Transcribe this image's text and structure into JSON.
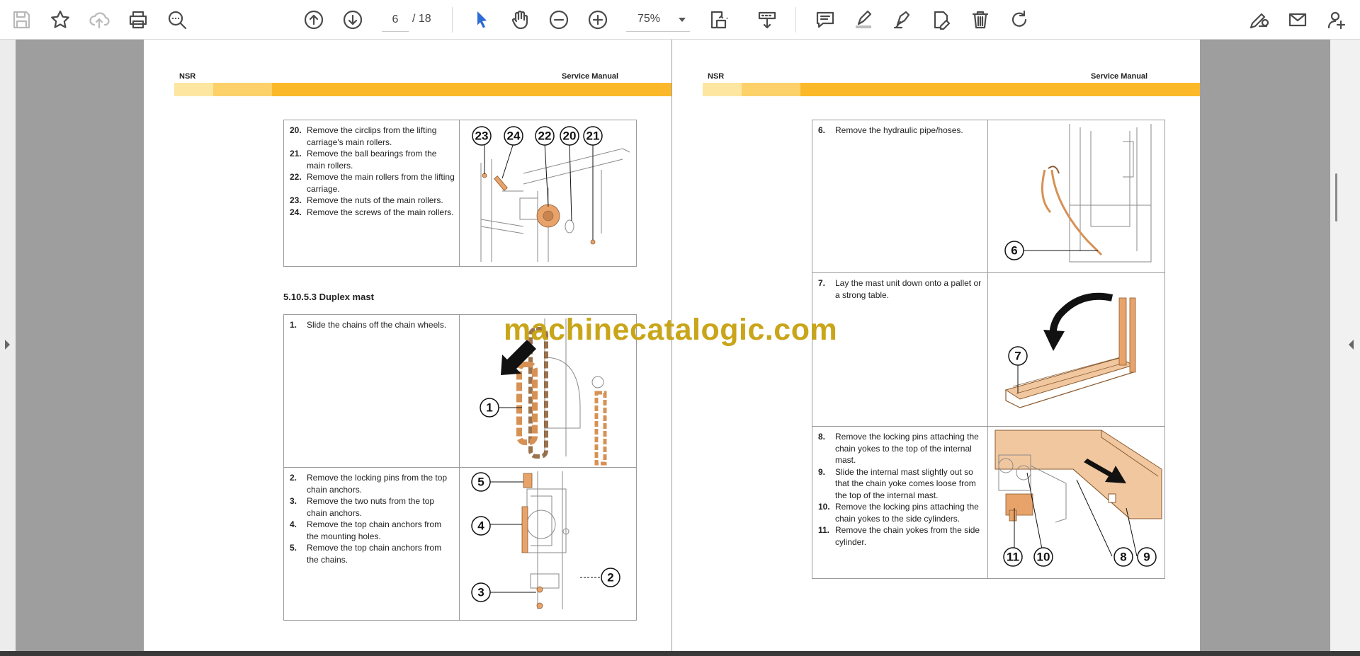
{
  "toolbar": {
    "tools": [
      {
        "name": "save",
        "icon": "save-icon",
        "enabled": false
      },
      {
        "name": "bookmark",
        "icon": "star-icon",
        "enabled": true
      },
      {
        "name": "upload",
        "icon": "cloud-upload-icon",
        "enabled": false
      },
      {
        "name": "print",
        "icon": "printer-icon",
        "enabled": true
      },
      {
        "name": "find",
        "icon": "search-icon",
        "enabled": true
      },
      {
        "name": "previous-page",
        "icon": "arrow-up-circle-icon",
        "enabled": true
      },
      {
        "name": "next-page",
        "icon": "arrow-down-circle-icon",
        "enabled": true
      },
      {
        "name": "select",
        "icon": "cursor-icon",
        "enabled": true,
        "active": true
      },
      {
        "name": "hand",
        "icon": "hand-icon",
        "enabled": true
      },
      {
        "name": "zoom-out",
        "icon": "minus-circle-icon",
        "enabled": true
      },
      {
        "name": "zoom-in",
        "icon": "plus-circle-icon",
        "enabled": true
      }
    ],
    "page_current": "6",
    "page_total": "/  18",
    "zoom": "75%",
    "accent_color": "#2d6bd6"
  },
  "watermark": "machinecatalogic.com",
  "left_page": {
    "header_left": "NSR",
    "header_right": "Service Manual",
    "band_colors": [
      "#fde6a0",
      "#fdd16a",
      "#fbb92a"
    ],
    "table1": {
      "steps": [
        {
          "n": "20.",
          "text": "Remove the circlips from the lifting carriage's main rollers."
        },
        {
          "n": "21.",
          "text": "Remove the ball bearings from the main rollers."
        },
        {
          "n": "22.",
          "text": "Remove the main rollers from the lifting carriage."
        },
        {
          "n": "23.",
          "text": "Remove the nuts of the main rollers."
        },
        {
          "n": "24.",
          "text": "Remove the screws of the main rollers."
        }
      ],
      "callouts": [
        "23",
        "24",
        "22",
        "20",
        "21"
      ]
    },
    "section_title": "5.10.5.3 Duplex mast",
    "table2": {
      "row1": {
        "steps": [
          {
            "n": "1.",
            "text": "Slide the chains off the chain wheels."
          }
        ],
        "callouts": [
          "1"
        ]
      },
      "row2": {
        "steps": [
          {
            "n": "2.",
            "text": "Remove the locking pins from the top chain anchors."
          },
          {
            "n": "3.",
            "text": "Remove the two nuts from the top chain anchors."
          },
          {
            "n": "4.",
            "text": "Remove the top chain anchors from the mounting holes."
          },
          {
            "n": "5.",
            "text": "Remove the top chain anchors from the chains."
          }
        ],
        "callouts": [
          "5",
          "4",
          "2",
          "3"
        ]
      }
    }
  },
  "right_page": {
    "header_left": "NSR",
    "header_right": "Service Manual",
    "table": {
      "row1": {
        "steps": [
          {
            "n": "6.",
            "text": "Remove the hydraulic pipe/hoses."
          }
        ],
        "callouts": [
          "6"
        ]
      },
      "row2": {
        "steps": [
          {
            "n": "7.",
            "text": "Lay the mast unit down onto a pallet or a strong table."
          }
        ],
        "callouts": [
          "7"
        ]
      },
      "row3": {
        "steps": [
          {
            "n": "8.",
            "text": "Remove the locking pins attaching the chain yokes to the top of the internal mast."
          },
          {
            "n": "9.",
            "text": "Slide the internal mast slightly out so that the chain yoke comes loose from the top of the internal mast."
          },
          {
            "n": "10.",
            "text": "Remove the locking pins attaching the chain yokes to the side cylinders."
          },
          {
            "n": "11.",
            "text": "Remove the chain yokes from the side cylinder."
          }
        ],
        "callouts": [
          "11",
          "10",
          "8",
          "9"
        ]
      }
    }
  }
}
